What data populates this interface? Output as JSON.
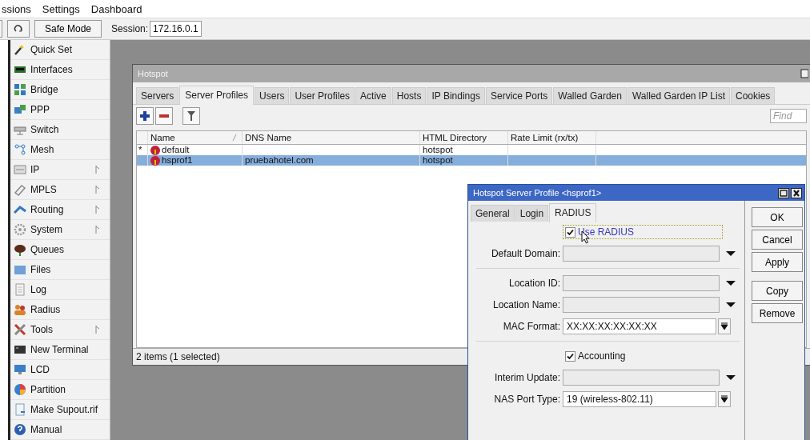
{
  "menu_bar": [
    {
      "label": "ssions"
    },
    {
      "label": "Settings"
    },
    {
      "label": "Dashboard"
    }
  ],
  "toolbar": {
    "safe_mode": "Safe Mode",
    "session_label": "Session:",
    "session_value": "172.16.0.1"
  },
  "sidebar": {
    "items": [
      {
        "label": "Quick Set",
        "kind": "wand",
        "has_submenu": false
      },
      {
        "label": "Interfaces",
        "kind": "card",
        "has_submenu": false
      },
      {
        "label": "Bridge",
        "kind": "bridge",
        "has_submenu": false
      },
      {
        "label": "PPP",
        "kind": "ppp",
        "has_submenu": false
      },
      {
        "label": "Switch",
        "kind": "switch",
        "has_submenu": false
      },
      {
        "label": "Mesh",
        "kind": "mesh",
        "has_submenu": false
      },
      {
        "label": "IP",
        "kind": "ip",
        "has_submenu": true
      },
      {
        "label": "MPLS",
        "kind": "mpls",
        "has_submenu": true
      },
      {
        "label": "Routing",
        "kind": "routing",
        "has_submenu": true
      },
      {
        "label": "System",
        "kind": "gear",
        "has_submenu": true
      },
      {
        "label": "Queues",
        "kind": "queues",
        "has_submenu": false
      },
      {
        "label": "Files",
        "kind": "folder",
        "has_submenu": false
      },
      {
        "label": "Log",
        "kind": "doc",
        "has_submenu": false
      },
      {
        "label": "Radius",
        "kind": "people",
        "has_submenu": false
      },
      {
        "label": "Tools",
        "kind": "tools",
        "has_submenu": true
      },
      {
        "label": "New Terminal",
        "kind": "terminal",
        "has_submenu": false
      },
      {
        "label": "LCD",
        "kind": "monitor",
        "has_submenu": false
      },
      {
        "label": "Partition",
        "kind": "pie",
        "has_submenu": false
      },
      {
        "label": "Make Supout.rif",
        "kind": "file",
        "has_submenu": false
      },
      {
        "label": "Manual",
        "kind": "help",
        "has_submenu": false
      }
    ]
  },
  "hotspot_window": {
    "title": "Hotspot",
    "tabs": [
      {
        "label": "Servers",
        "selected": false
      },
      {
        "label": "Server Profiles",
        "selected": true
      },
      {
        "label": "Users",
        "selected": false
      },
      {
        "label": "User Profiles",
        "selected": false
      },
      {
        "label": "Active",
        "selected": false
      },
      {
        "label": "Hosts",
        "selected": false
      },
      {
        "label": "IP Bindings",
        "selected": false
      },
      {
        "label": "Service Ports",
        "selected": false
      },
      {
        "label": "Walled Garden",
        "selected": false
      },
      {
        "label": "Walled Garden IP List",
        "selected": false
      },
      {
        "label": "Cookies",
        "selected": false
      }
    ],
    "find": {
      "placeholder": "Find"
    },
    "table": {
      "columns": [
        {
          "label": "Name",
          "sorted": true
        },
        {
          "label": "DNS Name",
          "sorted": false
        },
        {
          "label": "HTML Directory",
          "sorted": false
        },
        {
          "label": "Rate Limit (rx/tx)",
          "sorted": false
        }
      ],
      "rows": [
        {
          "flag": "*",
          "name": "default",
          "dns_name": "",
          "html_directory": "hotspot",
          "selected": false
        },
        {
          "name": "hsprof1",
          "dns_name": "pruebahotel.com",
          "html_directory": "hotspot",
          "selected": true
        }
      ]
    },
    "status_bar": "2 items (1 selected)"
  },
  "profile_dialog": {
    "title": "Hotspot Server Profile <hsprof1>",
    "tabs": [
      {
        "label": "General",
        "selected": false
      },
      {
        "label": "Login",
        "selected": false
      },
      {
        "label": "RADIUS",
        "selected": true
      }
    ],
    "fields": [
      {
        "kind": "checkbox",
        "label": "Use RADIUS",
        "checked": true,
        "focused": true
      },
      {
        "kind": "dropdown",
        "label": "Default Domain:"
      },
      {
        "kind": "separator"
      },
      {
        "kind": "dropdown",
        "label": "Location ID:"
      },
      {
        "kind": "dropdown",
        "label": "Location Name:"
      },
      {
        "kind": "select",
        "label": "MAC Format:",
        "value": "XX:XX:XX:XX:XX:XX"
      },
      {
        "kind": "separator"
      },
      {
        "kind": "checkbox",
        "label": "Accounting",
        "checked": true,
        "focused": false
      },
      {
        "kind": "dropdown",
        "label": "Interim Update:"
      },
      {
        "kind": "select",
        "label": "NAS Port Type:",
        "value": "19 (wireless-802.11)"
      }
    ],
    "button_groups": [
      [
        "OK",
        "Cancel",
        "Apply"
      ],
      [
        "Copy",
        "Remove"
      ]
    ]
  }
}
